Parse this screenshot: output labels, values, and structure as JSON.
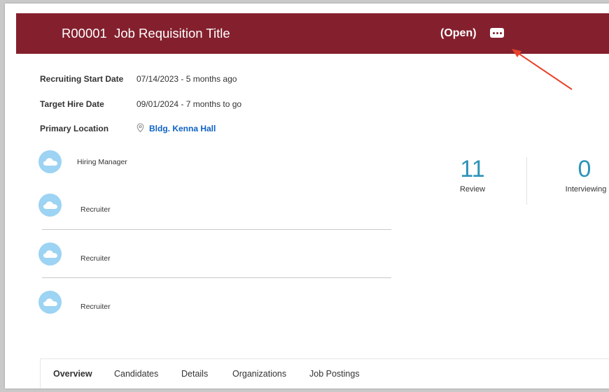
{
  "header": {
    "title": "R00001  Job Requisition Title",
    "status": "(Open)",
    "more_icon": "ellipsis-icon",
    "banner_color": "#84202e"
  },
  "fields": {
    "start_date_label": "Recruiting Start Date",
    "start_date_value": "07/14/2023 - 5 months ago",
    "target_date_label": "Target Hire Date",
    "target_date_value": "09/01/2024 - 7 months to go",
    "location_label": "Primary Location",
    "location_value": "Bldg. Kenna Hall",
    "location_icon": "location-pin-icon"
  },
  "people": [
    {
      "role": "Hiring Manager",
      "icon": "cloud-avatar-icon"
    },
    {
      "role": "Recruiter",
      "icon": "cloud-avatar-icon"
    },
    {
      "role": "Recruiter",
      "icon": "cloud-avatar-icon"
    },
    {
      "role": "Recruiter",
      "icon": "cloud-avatar-icon"
    }
  ],
  "metrics": [
    {
      "value": "11",
      "label": "Review"
    },
    {
      "value": "0",
      "label": "Interviewing"
    }
  ],
  "tabs": [
    {
      "label": "Overview",
      "active": true
    },
    {
      "label": "Candidates",
      "active": false
    },
    {
      "label": "Details",
      "active": false
    },
    {
      "label": "Organizations",
      "active": false
    },
    {
      "label": "Job Postings",
      "active": false
    }
  ],
  "colors": {
    "accent": "#84202e",
    "link": "#0e62c4",
    "metric": "#2e93b9",
    "avatar": "#9dd3f3",
    "annotation_arrow": "#e8432b"
  }
}
